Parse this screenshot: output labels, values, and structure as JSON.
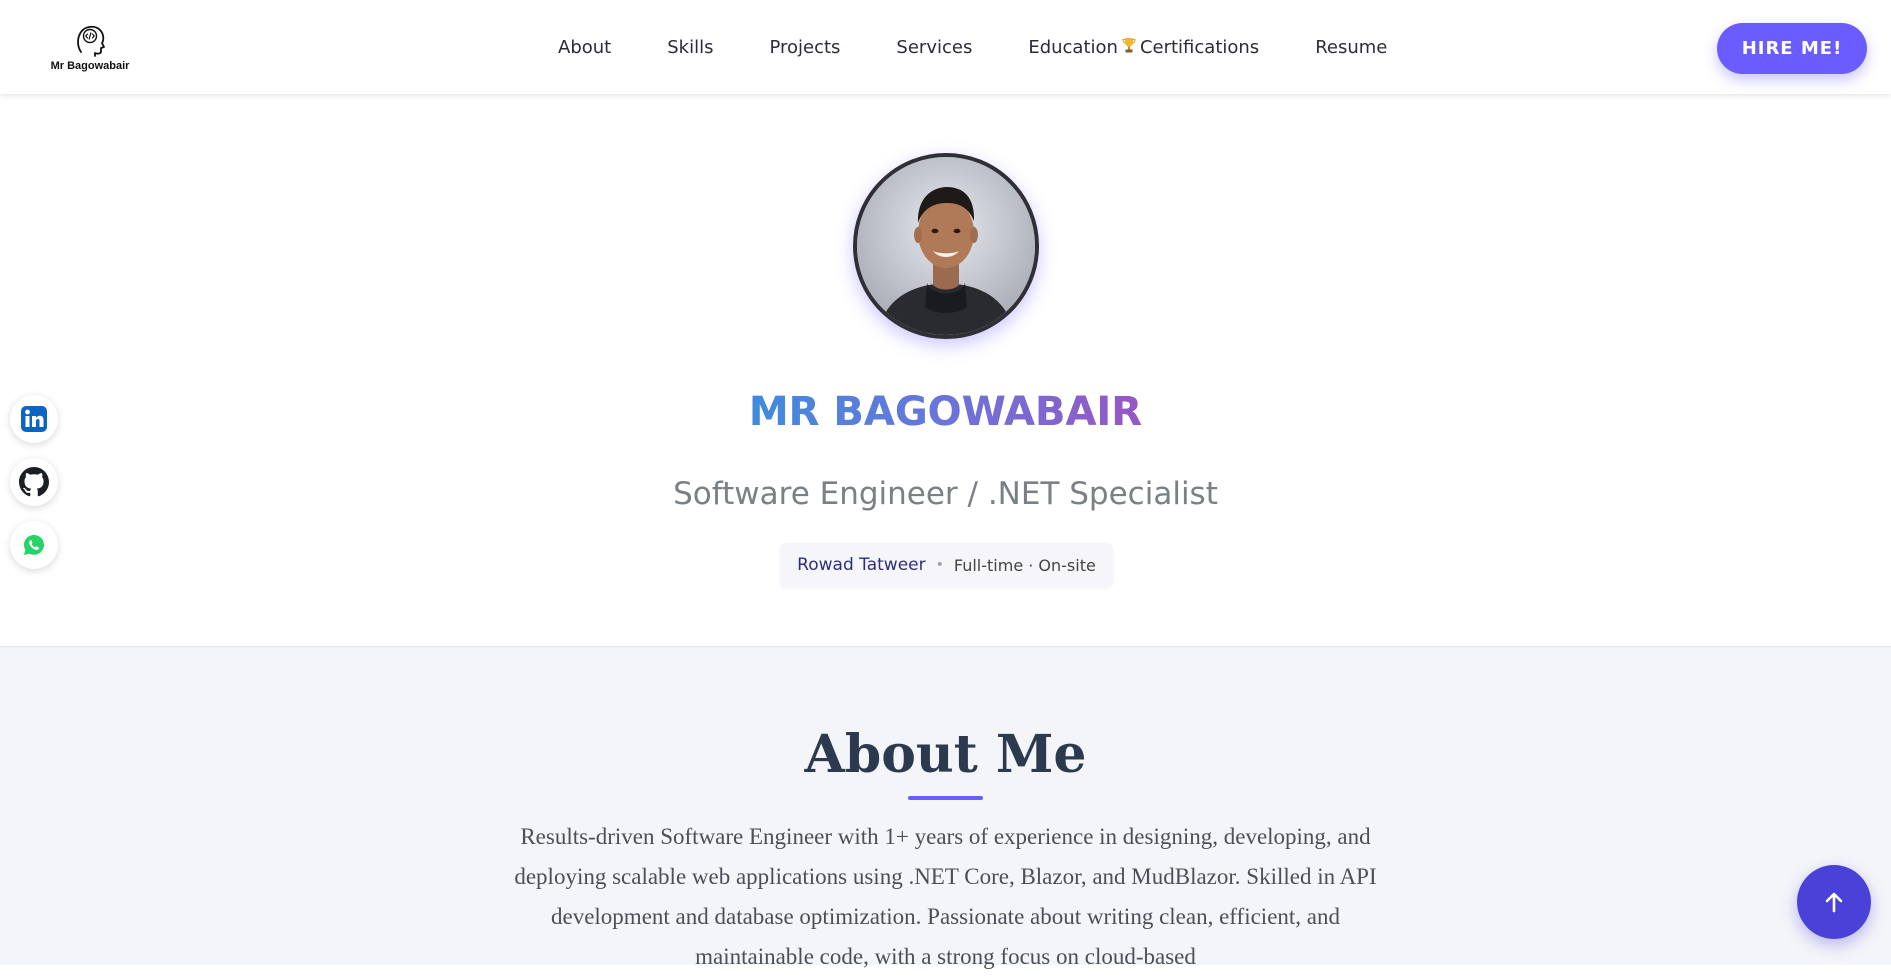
{
  "brand": {
    "logo_text": "Mr Bagowabair",
    "logo_icon": "head-code-icon"
  },
  "nav": {
    "items": [
      {
        "label": "About"
      },
      {
        "label": "Skills"
      },
      {
        "label": "Projects"
      },
      {
        "label": "Services"
      },
      {
        "label_a": "Education",
        "icon": "trophy-icon",
        "label_b": "Certifications"
      },
      {
        "label": "Resume"
      }
    ],
    "hire_label": "HIRE ME!"
  },
  "hero": {
    "name": "MR BAGOWABAIR",
    "role": "Software Engineer / .NET Specialist",
    "company": "Rowad Tatweer",
    "separator": "•",
    "employment": "Full-time · On-site"
  },
  "social": [
    {
      "icon": "linkedin-icon",
      "color": "#0a66c2"
    },
    {
      "icon": "github-icon",
      "color": "#1b1f23"
    },
    {
      "icon": "whatsapp-icon",
      "color": "#25d366"
    }
  ],
  "about": {
    "title": "About Me",
    "text": "Results-driven Software Engineer with 1+ years of experience in designing, developing, and deploying scalable web applications using .NET Core, Blazor, and MudBlazor. Skilled in API development and database optimization. Passionate about writing clean, efficient, and maintainable code, with a strong focus on cloud-based"
  },
  "colors": {
    "accent": "#6a5cff",
    "scroll_top": "#4a42d8",
    "name_gradient_start": "#3f8cdb",
    "name_gradient_end": "#9757c4"
  }
}
